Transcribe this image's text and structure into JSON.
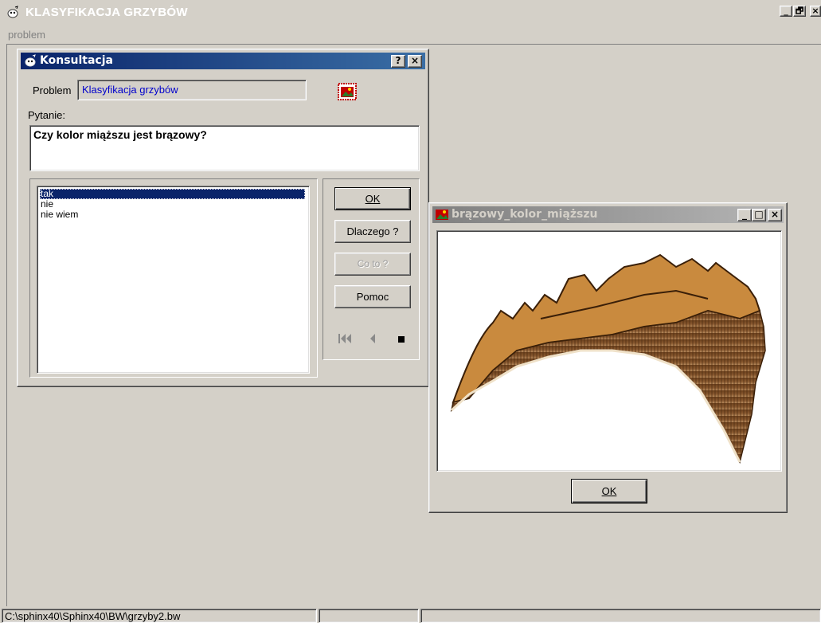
{
  "main_window": {
    "title": "KLASYFIKACJA GRZYBÓW",
    "icon": "app-icon",
    "controls": {
      "minimize": "_",
      "maximize": "🗗",
      "close": "×"
    }
  },
  "menu": {
    "items": [
      "problem"
    ]
  },
  "dialog": {
    "title": "Konsultacja",
    "help_button": "?",
    "close_button": "×",
    "problem_label": "Problem",
    "problem_value": "Klasyfikacja grzybów",
    "question_label": "Pytanie:",
    "question_text": "Czy kolor miąższu jest brązowy?",
    "answers": [
      "tak",
      "nie",
      "nie wiem"
    ],
    "selected_answer": "tak",
    "buttons": {
      "ok": "OK",
      "dlaczego": "Dlaczego ?",
      "coto": "Co to ?",
      "pomoc": "Pomoc"
    },
    "nav_icons": [
      "first-icon",
      "back-icon",
      "stop-icon"
    ]
  },
  "image_window": {
    "title": "brązowy_kolor_miąższu",
    "ok_button": "OK",
    "image_subject": "brown mushroom flesh cross-section"
  },
  "statusbar": {
    "path": "C:\\sphinx40\\Sphinx40\\BW\\grzyby2.bw",
    "pane2": "",
    "pane3": ""
  },
  "colors": {
    "face": "#d4d0c8",
    "active_title": "#0a246a",
    "inactive_title": "#808080",
    "link_blue": "#0000cc"
  }
}
